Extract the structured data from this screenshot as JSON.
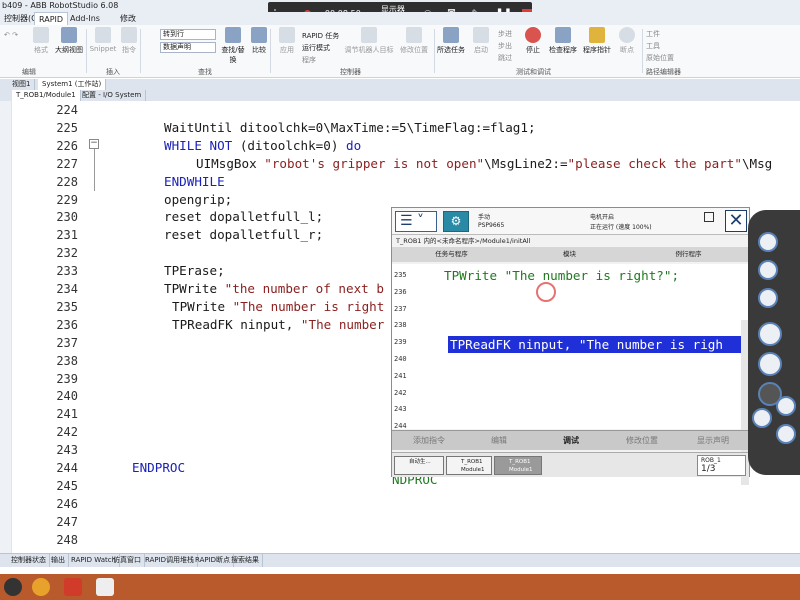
{
  "title_bar": {
    "text": "b409 - ABB RobotStudio 6.08"
  },
  "recorder": {
    "time": "00:08:50",
    "display": "显示器2"
  },
  "menu": {
    "items": [
      "控制器(C)",
      "RAPID",
      "Add-Ins",
      "修改"
    ],
    "active": "RAPID"
  },
  "ribbon": {
    "edit_items": [
      "格式",
      "大纲视图"
    ],
    "insert_items": [
      "Snippet",
      "指令"
    ],
    "search": {
      "goto_line": "转到行",
      "data_decl": "数据声明",
      "find_replace": "查找/替换",
      "compare": "比较"
    },
    "controller_items": [
      "应用",
      "RAPID 任务",
      "运行模式",
      "程序",
      "调节机器人目标",
      "修改位置"
    ],
    "test_items": [
      "所选任务",
      "启动",
      "步进",
      "步出",
      "跳过",
      "停止",
      "检查程序",
      "程序指针",
      "断点"
    ],
    "path_items": [
      "工件",
      "工具",
      "原始位置"
    ],
    "groups": [
      "编辑",
      "插入",
      "查找",
      "控制器",
      "测试和调试",
      "路径编辑器"
    ]
  },
  "doc_tabs": {
    "row1": [
      "视图1",
      "System1 (工作站)"
    ],
    "row2": [
      "T_ROB1/Module1",
      "配置 - I/O System"
    ]
  },
  "editor": {
    "lines": [
      {
        "n": "224",
        "code": ""
      },
      {
        "n": "225",
        "code": "WaitUntil ditoolchk=0\\MaxTime:=5\\TimeFlag:=flag1;"
      },
      {
        "n": "226",
        "code": "WHILE NOT (ditoolchk=0) do"
      },
      {
        "n": "227",
        "code": "UIMsgBox \"robot's gripper is not open\"\\MsgLine2:=\"please check the part\"\\Msg"
      },
      {
        "n": "228",
        "code": "ENDWHILE"
      },
      {
        "n": "229",
        "code": "opengrip;"
      },
      {
        "n": "230",
        "code": "reset dopalletfull_l;"
      },
      {
        "n": "231",
        "code": "reset dopalletfull_r;"
      },
      {
        "n": "232",
        "code": ""
      },
      {
        "n": "233",
        "code": "TPErase;"
      },
      {
        "n": "234",
        "code": "TPWrite \"the number of next b"
      },
      {
        "n": "235",
        "code": "TPWrite \"The number is right"
      },
      {
        "n": "236",
        "code": "TPReadFK ninput, \"The number"
      },
      {
        "n": "237",
        "code": ""
      },
      {
        "n": "238",
        "code": ""
      },
      {
        "n": "239",
        "code": ""
      },
      {
        "n": "240",
        "code": ""
      },
      {
        "n": "241",
        "code": ""
      },
      {
        "n": "242",
        "code": ""
      },
      {
        "n": "243",
        "code": ""
      },
      {
        "n": "244",
        "code": "ENDPROC"
      },
      {
        "n": "245",
        "code": ""
      },
      {
        "n": "246",
        "code": ""
      },
      {
        "n": "247",
        "code": ""
      },
      {
        "n": "248",
        "code": ""
      }
    ]
  },
  "bottom_tabs": [
    "控制器状态",
    "输出",
    "RAPID Watch",
    "仿真窗口",
    "RAPID调用堆栈",
    "RAPID断点",
    "搜索结果"
  ],
  "pendant": {
    "mode": "手动",
    "system": "PSP9665",
    "motors": "电机开启",
    "run_state": "正在运行 (速度 100%)",
    "path": "T_ROB1 内的<未命名程序>/Module1/initAll",
    "col_task": "任务与程序",
    "col_module": "模块",
    "col_routine": "例行程序",
    "lines": [
      {
        "n": "235",
        "code": "TPWrite \"The number is right?\";"
      },
      {
        "n": "236",
        "code": "TPReadFK ninput, \"The number is righ"
      },
      {
        "n": "237",
        "code": ""
      },
      {
        "n": "238",
        "code": ""
      },
      {
        "n": "239",
        "code": ""
      },
      {
        "n": "240",
        "code": ""
      },
      {
        "n": "241",
        "code": ""
      },
      {
        "n": "242",
        "code": ""
      },
      {
        "n": "243",
        "code": ""
      },
      {
        "n": "244",
        "code": ""
      }
    ],
    "endproc": "NDPROC",
    "buttons": [
      "添加指令",
      "编辑",
      "调试",
      "修改位置",
      "显示声明"
    ],
    "active_button": "调试",
    "tasks": [
      {
        "label": "自动生...",
        "sub": ""
      },
      {
        "label": "T_ROB1",
        "sub": "Module1"
      },
      {
        "label": "T_ROB1",
        "sub": "Module1"
      }
    ],
    "rob": "ROB_1",
    "rob_fraction": "1/3"
  }
}
